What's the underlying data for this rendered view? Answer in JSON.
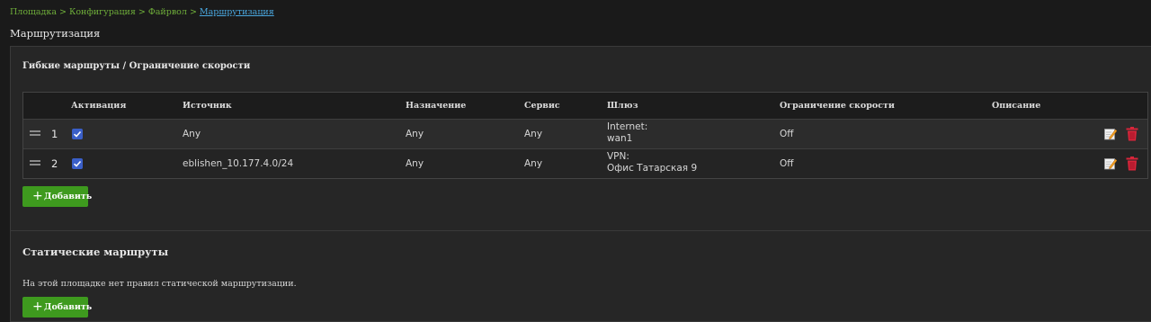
{
  "breadcrumb": {
    "items": [
      "Площадка",
      "Конфигурация",
      "Файрвол"
    ],
    "separator": ">",
    "current": "Маршрутизация"
  },
  "page_title": "Маршрутизация",
  "flexible_routes": {
    "title": "Гибкие маршруты / Ограничение скорости",
    "columns": [
      "Активация",
      "Источник",
      "Назначение",
      "Сервис",
      "Шлюз",
      "Ограничение скорости",
      "Описание"
    ],
    "rows": [
      {
        "num": "1",
        "active": true,
        "source": "Any",
        "destination": "Any",
        "service": "Any",
        "gateway_type": "Internet:",
        "gateway_name": "wan1",
        "speed_limit": "Off",
        "description": ""
      },
      {
        "num": "2",
        "active": true,
        "source": "eblishen_10.177.4.0/24",
        "destination": "Any",
        "service": "Any",
        "gateway_type": "VPN:",
        "gateway_name": "Офис Татарская 9",
        "speed_limit": "Off",
        "description": ""
      }
    ],
    "add_label": "Добавить"
  },
  "static_routes": {
    "title": "Статические маршруты",
    "empty_message": "На этой площадке нет правил статической маршрутизации.",
    "add_label": "Добавить"
  },
  "icons": {
    "drag": "drag-handle-icon",
    "edit": "edit-icon",
    "delete": "trash-icon",
    "add": "plus-icon"
  },
  "colors": {
    "accent_green": "#3e9a1e",
    "link_blue": "#4aa8e0",
    "breadcrumb_green": "#6fae3a",
    "delete_red": "#d8253a",
    "checkbox_blue": "#3a5fc8"
  }
}
